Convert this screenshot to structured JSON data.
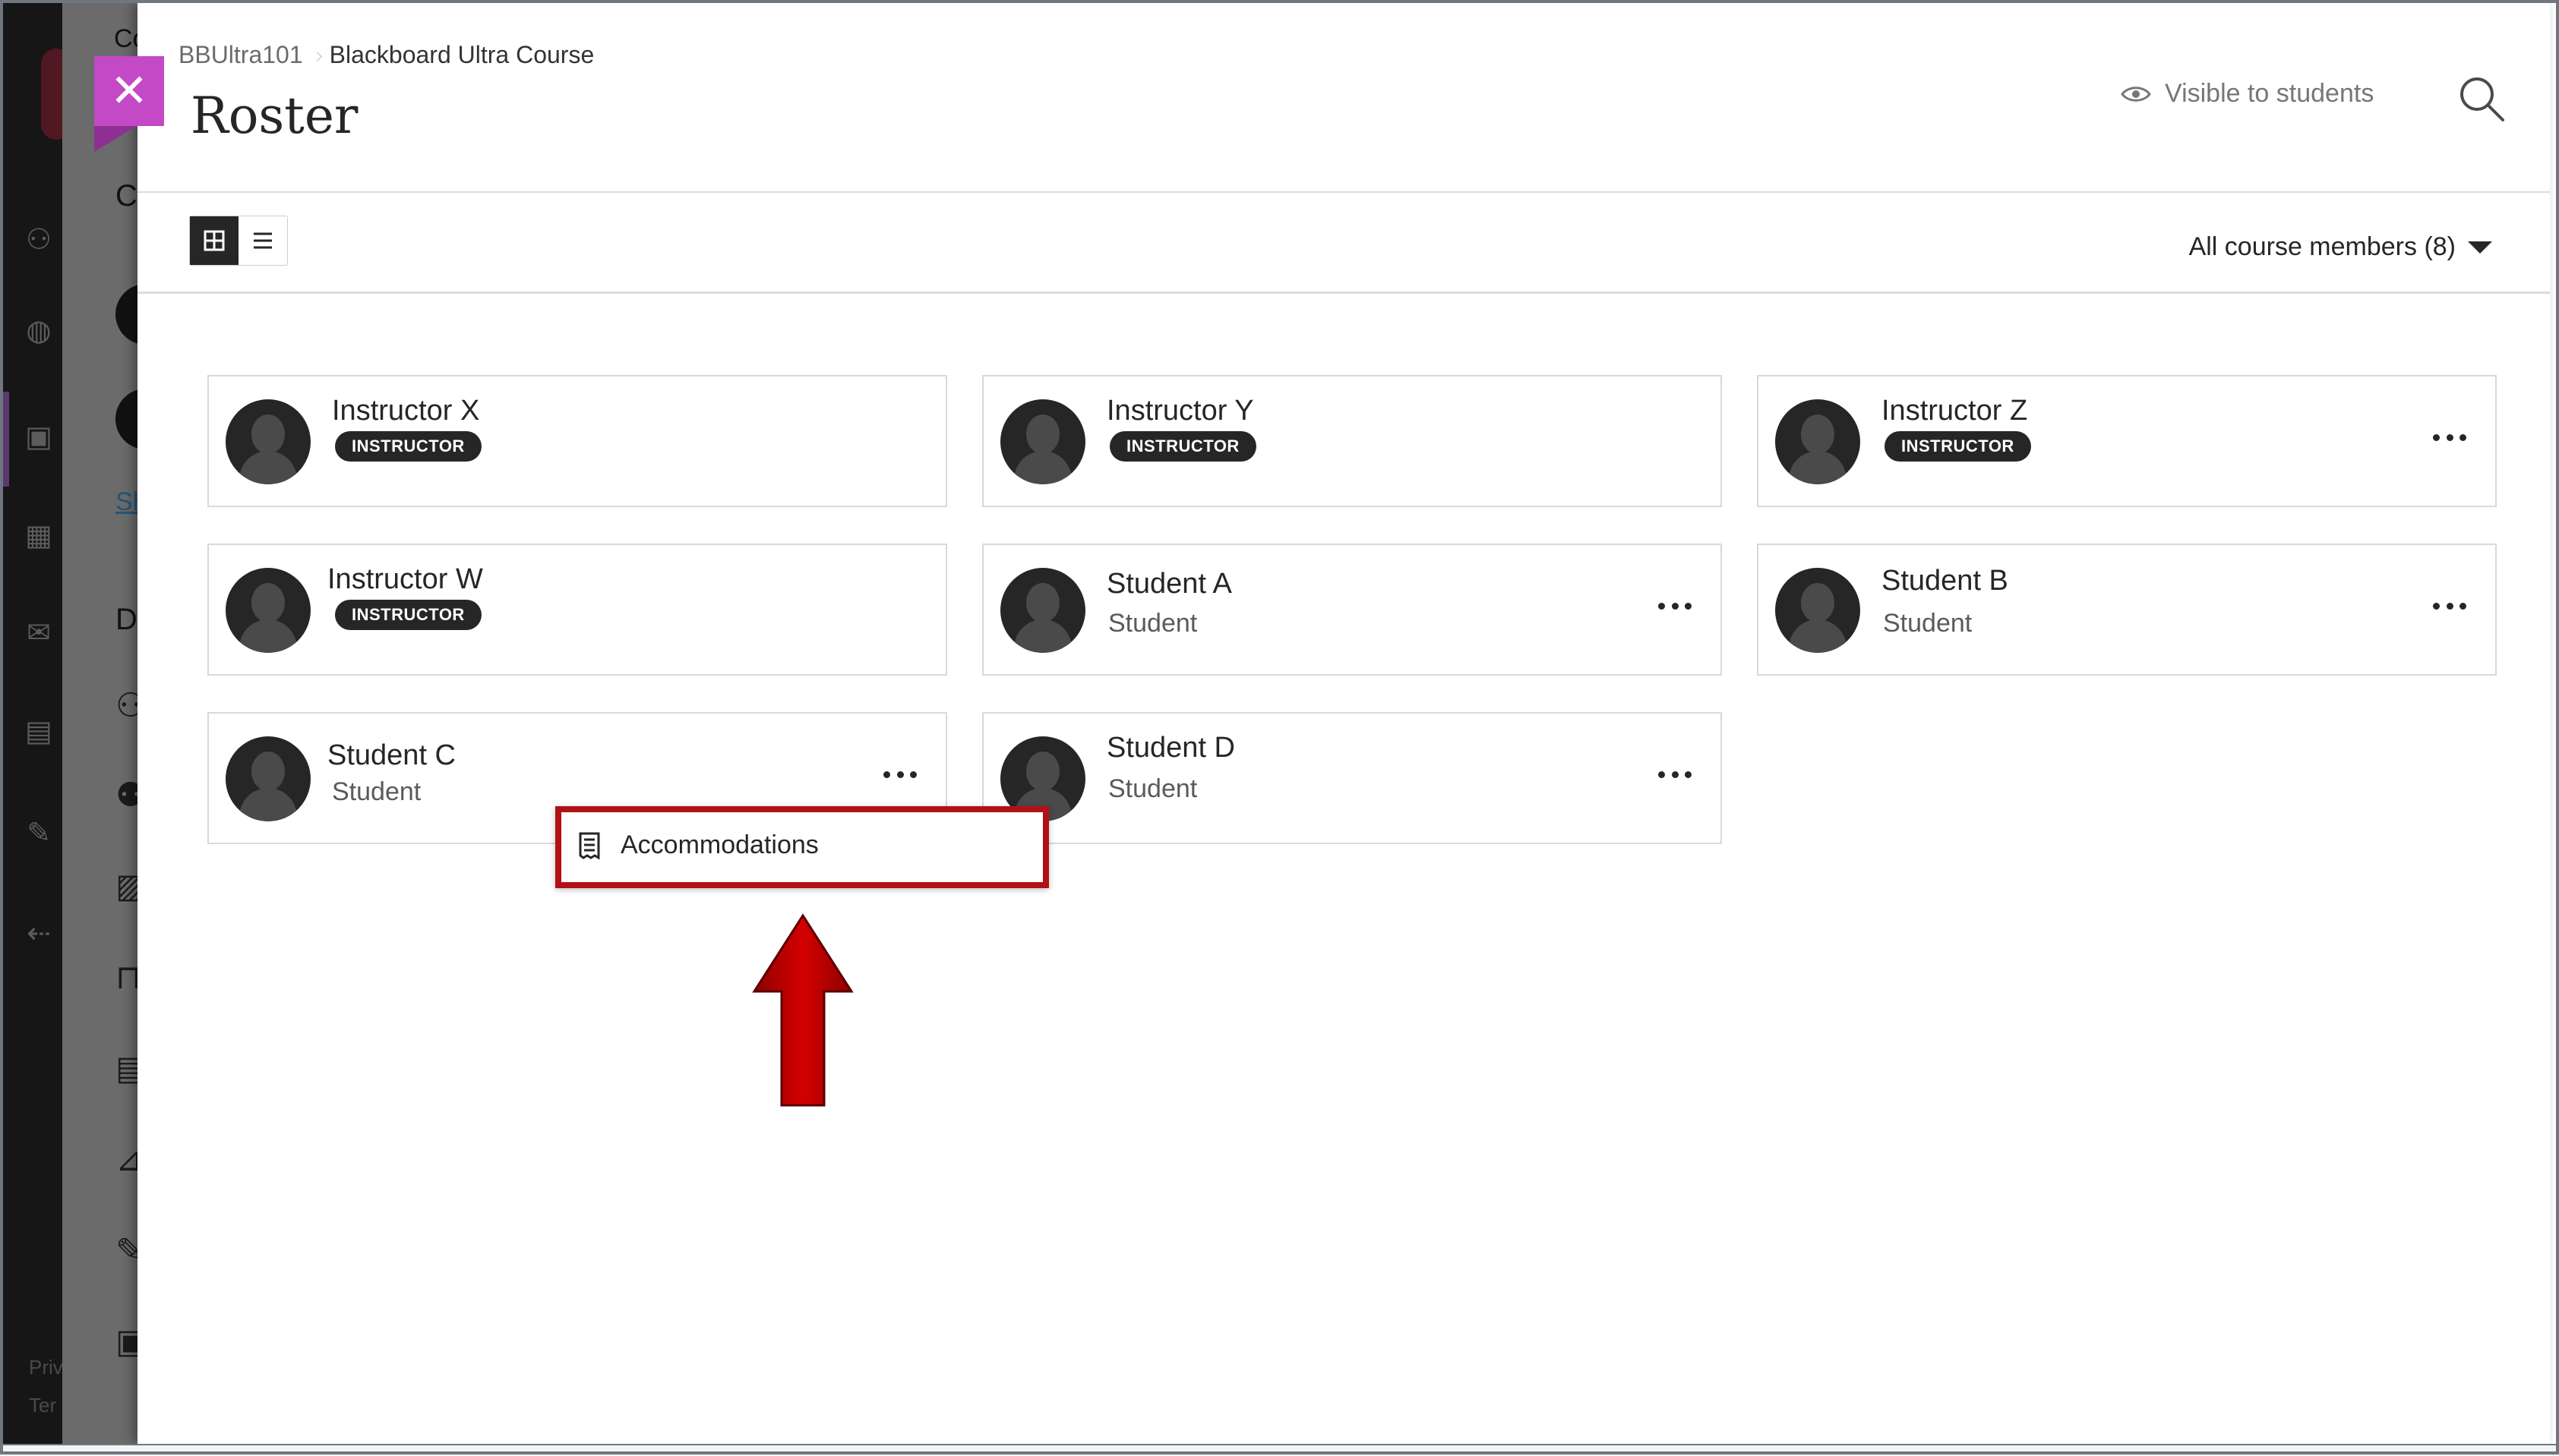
{
  "background": {
    "fragments": [
      "Co",
      "C",
      "D"
    ],
    "link_text": "Sh",
    "footer": [
      "Priv",
      "Ter"
    ]
  },
  "breadcrumb": {
    "course_id": "BBUltra101",
    "course_name": "Blackboard Ultra Course"
  },
  "page": {
    "title": "Roster"
  },
  "header": {
    "visibility_label": "Visible to students"
  },
  "toolbar": {
    "filter_label": "All course members (8)"
  },
  "members": [
    {
      "name": "Instructor X",
      "role": "INSTRUCTOR",
      "role_type": "badge",
      "has_menu": false
    },
    {
      "name": "Instructor Y",
      "role": "INSTRUCTOR",
      "role_type": "badge",
      "has_menu": false
    },
    {
      "name": "Instructor Z",
      "role": "INSTRUCTOR",
      "role_type": "badge",
      "has_menu": true
    },
    {
      "name": "Instructor W",
      "role": "INSTRUCTOR",
      "role_type": "badge",
      "has_menu": false
    },
    {
      "name": "Student A",
      "role": "Student",
      "role_type": "text",
      "has_menu": true
    },
    {
      "name": "Student B",
      "role": "Student",
      "role_type": "text",
      "has_menu": true
    },
    {
      "name": "Student C",
      "role": "Student",
      "role_type": "text",
      "has_menu": true
    },
    {
      "name": "Student D",
      "role": "Student",
      "role_type": "text",
      "has_menu": true
    }
  ],
  "context_menu": {
    "item_label": "Accommodations",
    "item_icon": "document-list-icon"
  },
  "colors": {
    "close_button": "#c349c7",
    "badge_bg": "#262626",
    "highlight": "#b11116",
    "arrow": "#c00000"
  }
}
